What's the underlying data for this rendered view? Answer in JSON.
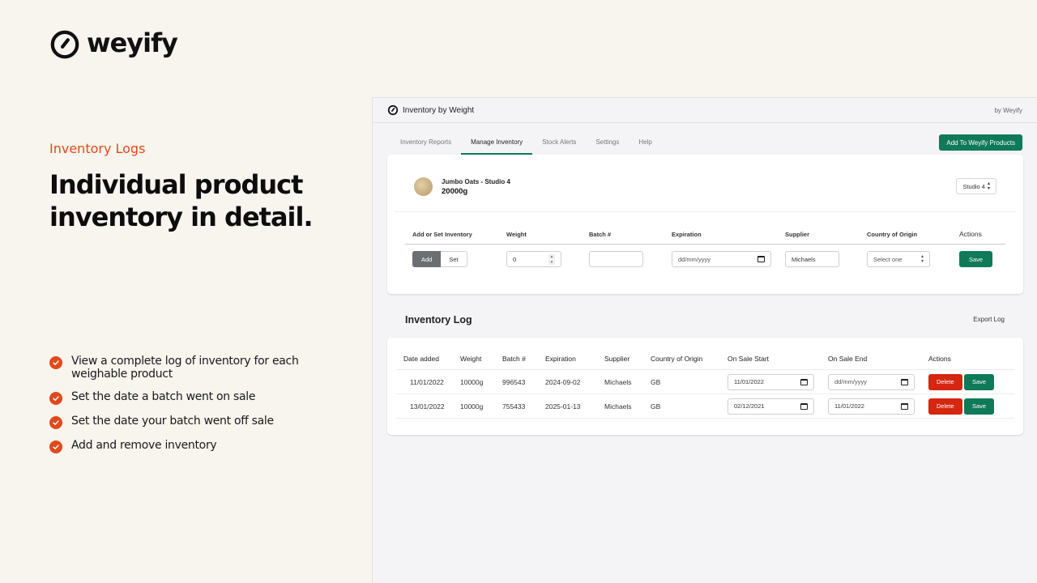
{
  "brand": {
    "name": "weyify",
    "logo_icon": "stopwatch-icon"
  },
  "marketing": {
    "eyebrow": "Inventory Logs",
    "headline": "Individual product inventory in detail.",
    "features": [
      "View a complete log of inventory for each weighable product",
      "Set the date a batch went on sale",
      "Set the date your batch went off sale",
      "Add and remove inventory"
    ],
    "accent_color": "#e04a1c"
  },
  "app": {
    "title": "Inventory by Weight",
    "by_label": "by Weyify",
    "tabs": [
      {
        "label": "Inventory Reports",
        "active": false
      },
      {
        "label": "Manage Inventory",
        "active": true
      },
      {
        "label": "Stock Alerts",
        "active": false
      },
      {
        "label": "Settings",
        "active": false
      },
      {
        "label": "Help",
        "active": false
      }
    ],
    "primary_button": "Add To Weyify Products",
    "primary_color": "#0f7a57",
    "danger_color": "#d5260f"
  },
  "product": {
    "name": "Jumbo Oats - Studio 4",
    "weight": "20000g",
    "location_selected": "Studio 4"
  },
  "form": {
    "headers": [
      "Add or Set Inventory",
      "Weight",
      "Batch #",
      "Expiration",
      "Supplier",
      "Country of Origin",
      "Actions"
    ],
    "mode_options": [
      "Add",
      "Set"
    ],
    "mode_selected": "Add",
    "weight_value": "0",
    "batch_value": "",
    "expiration_placeholder": "dd/mm/yyyy",
    "supplier_value": "Michaels",
    "country_placeholder": "Select one",
    "save_label": "Save"
  },
  "log": {
    "title": "Inventory Log",
    "export_label": "Export Log",
    "headers": [
      "Date added",
      "Weight",
      "Batch #",
      "Expiration",
      "Supplier",
      "Country of Origin",
      "On Sale Start",
      "On Sale End",
      "Actions"
    ],
    "rows": [
      {
        "date_added": "11/01/2022",
        "weight": "10000g",
        "batch": "996543",
        "expiration": "2024-09-02",
        "supplier": "Michaels",
        "country": "GB",
        "on_sale_start": "11/01/2022",
        "on_sale_end": "dd/mm/yyyy",
        "delete_label": "Delete",
        "save_label": "Save"
      },
      {
        "date_added": "13/01/2022",
        "weight": "10000g",
        "batch": "755433",
        "expiration": "2025-01-13",
        "supplier": "Michaels",
        "country": "GB",
        "on_sale_start": "02/12/2021",
        "on_sale_end": "11/01/2022",
        "delete_label": "Delete",
        "save_label": "Save"
      }
    ]
  }
}
